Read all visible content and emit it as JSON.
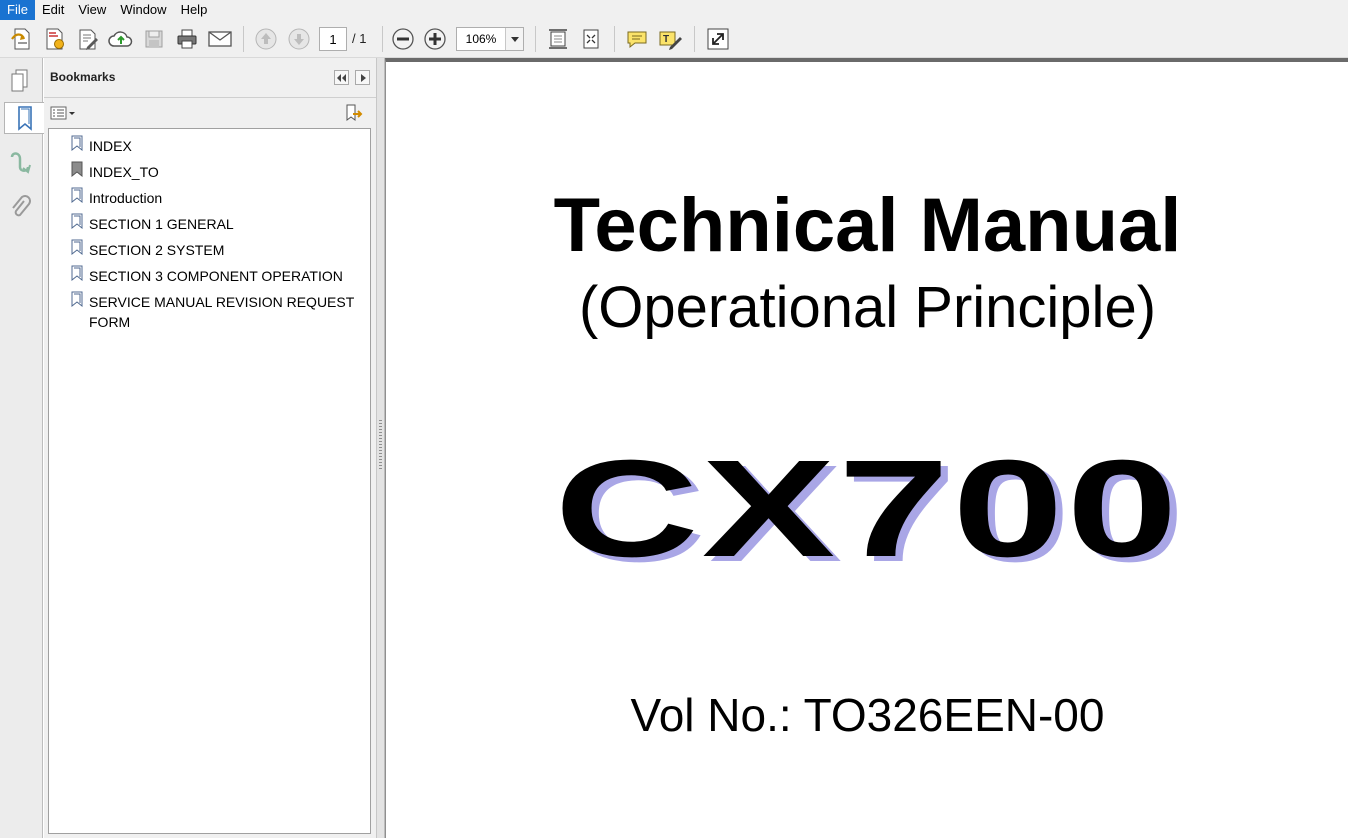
{
  "menu": {
    "items": [
      {
        "label": "File",
        "active": true
      },
      {
        "label": "Edit",
        "active": false
      },
      {
        "label": "View",
        "active": false
      },
      {
        "label": "Window",
        "active": false
      },
      {
        "label": "Help",
        "active": false
      }
    ]
  },
  "toolbar": {
    "page_current": "1",
    "page_total": "/ 1",
    "zoom": "106%"
  },
  "bookmarks": {
    "title": "Bookmarks",
    "items": [
      {
        "label": "INDEX"
      },
      {
        "label": "INDEX_TO"
      },
      {
        "label": "Introduction"
      },
      {
        "label": "SECTION 1 GENERAL"
      },
      {
        "label": "SECTION 2 SYSTEM"
      },
      {
        "label": "SECTION 3 COMPONENT OPERATION"
      },
      {
        "label": "SERVICE MANUAL REVISION REQUEST FORM"
      }
    ]
  },
  "document": {
    "title": "Technical Manual",
    "subtitle": "(Operational Principle)",
    "model": "CX700",
    "vol": "Vol No.: TO326EEN-00"
  },
  "colors": {
    "menu_active": "#1a73d1",
    "model_shadow": "#a9a6e6"
  }
}
